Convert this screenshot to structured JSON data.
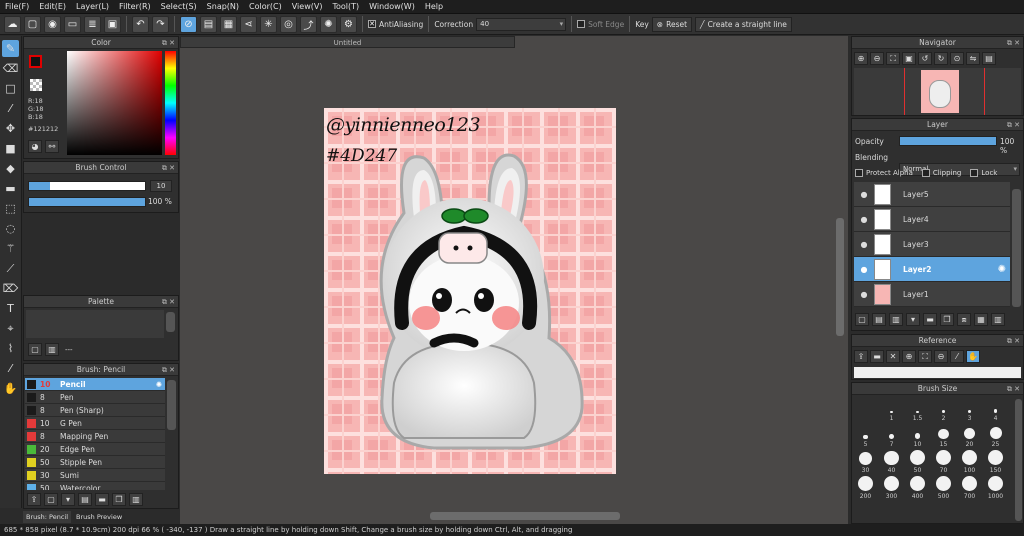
{
  "menu": [
    "File(F)",
    "Edit(E)",
    "Layer(L)",
    "Filter(R)",
    "Select(S)",
    "Snap(N)",
    "Color(C)",
    "View(V)",
    "Tool(T)",
    "Window(W)",
    "Help"
  ],
  "toolbar": {
    "antialiasing_label": "AntiAliasing",
    "correction_label": "Correction",
    "correction_value": "40",
    "soft_edge_label": "Soft Edge",
    "key_label": "Key",
    "reset_label": "Reset",
    "straight_line_label": "Create a straight line"
  },
  "color_panel": {
    "title": "Color",
    "r": "R:18",
    "g": "G:18",
    "b": "B:18",
    "hex": "#121212",
    "fg_color": "#121212",
    "accent": "#e00000"
  },
  "brush_control": {
    "title": "Brush Control",
    "size_value": "10",
    "opacity_value": "100 %",
    "size_fraction": 0.18,
    "opacity_fraction": 1.0
  },
  "palette": {
    "title": "Palette",
    "more": "---"
  },
  "brush_panel": {
    "title": "Brush: Pencil",
    "items": [
      {
        "size": "10",
        "name": "Pencil",
        "color": "#1a1a1a",
        "selected": true
      },
      {
        "size": "8",
        "name": "Pen",
        "color": "#1a1a1a"
      },
      {
        "size": "8",
        "name": "Pen (Sharp)",
        "color": "#1a1a1a"
      },
      {
        "size": "10",
        "name": "G Pen",
        "color": "#e33a3a"
      },
      {
        "size": "8",
        "name": "Mapping Pen",
        "color": "#e33a3a"
      },
      {
        "size": "20",
        "name": "Edge Pen",
        "color": "#4aba3a"
      },
      {
        "size": "50",
        "name": "Stipple Pen",
        "color": "#e0d020"
      },
      {
        "size": "30",
        "name": "Sumi",
        "color": "#e0d020"
      },
      {
        "size": "50",
        "name": "Watercolor",
        "color": "#5eb0e8"
      }
    ]
  },
  "bottom_tabs": [
    "Brush: Pencil",
    "Brush Preview"
  ],
  "document": {
    "tab_title": "Untitled",
    "signature_text": "@yinnienneo123",
    "hashtag_text": "#4D247"
  },
  "navigator": {
    "title": "Navigator"
  },
  "layer_panel": {
    "title": "Layer",
    "opacity_label": "Opacity",
    "opacity_value": "100 %",
    "blending_label": "Blending",
    "blending_value": "Normal",
    "protect_alpha_label": "Protect Alpha",
    "clipping_label": "Clipping",
    "lock_label": "Lock",
    "layers": [
      {
        "name": "Layer5",
        "selected": false
      },
      {
        "name": "Layer4",
        "selected": false
      },
      {
        "name": "Layer3",
        "selected": false
      },
      {
        "name": "Layer2",
        "selected": true
      },
      {
        "name": "Layer1",
        "selected": false
      }
    ]
  },
  "reference": {
    "title": "Reference"
  },
  "brush_size_panel": {
    "title": "Brush Size",
    "sizes": [
      "1",
      "1.5",
      "2",
      "3",
      "4",
      "5",
      "7",
      "10",
      "15",
      "20",
      "25",
      "30",
      "40",
      "50",
      "70",
      "100",
      "150",
      "200",
      "300",
      "400",
      "500",
      "700",
      "1000"
    ]
  },
  "status": "685 * 858 pixel  (8.7 * 10.9cm)  200 dpi  66 %  ( -340, -137 )  Draw a straight line by holding down Shift, Change a brush size by holding down Ctrl, Alt, and dragging"
}
